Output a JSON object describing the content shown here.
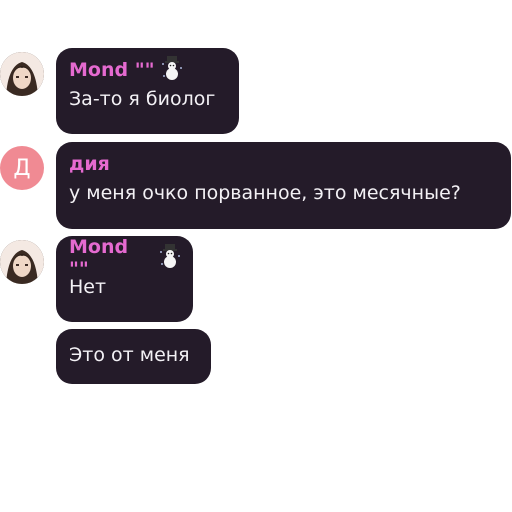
{
  "messages": [
    {
      "author": "Mond \"\"",
      "text": "За-то я биолог",
      "avatar": "anime-character-avatar",
      "badge_icon": "snowman-icon"
    },
    {
      "author": "дия",
      "text": "у меня очко порванное, это месячные?",
      "avatar_letter": "Д",
      "avatar_color": "#f08a93"
    },
    {
      "author": "Mond \"\"",
      "text": "Нет",
      "avatar": "anime-character-avatar",
      "badge_icon": "snowman-icon"
    },
    {
      "text": "Это от меня"
    }
  ],
  "colors": {
    "bubble": "#241b29",
    "name_accent": "#e56ad0",
    "text": "#f3f1f5"
  }
}
